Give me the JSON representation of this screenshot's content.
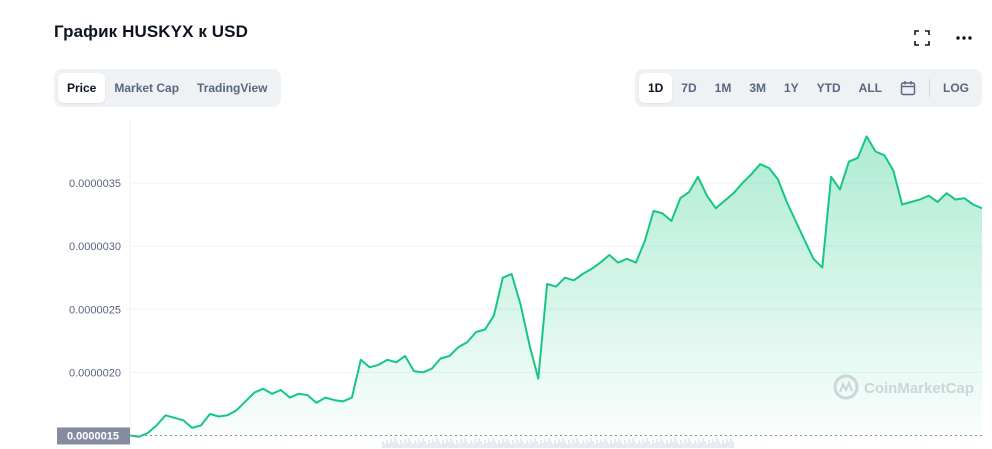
{
  "header": {
    "title": "График HUSKYX к USD"
  },
  "tabs_left": [
    {
      "label": "Price",
      "active": true
    },
    {
      "label": "Market Cap",
      "active": false
    },
    {
      "label": "TradingView",
      "active": false
    }
  ],
  "tabs_right": [
    {
      "label": "1D",
      "active": true
    },
    {
      "label": "7D",
      "active": false
    },
    {
      "label": "1M",
      "active": false
    },
    {
      "label": "3M",
      "active": false
    },
    {
      "label": "1Y",
      "active": false
    },
    {
      "label": "YTD",
      "active": false
    },
    {
      "label": "ALL",
      "active": false
    }
  ],
  "log_label": "LOG",
  "icons": {
    "fullscreen": "fullscreen-icon",
    "more": "more-icon",
    "calendar": "calendar-icon"
  },
  "watermark": "CoinMarketCap",
  "colors": {
    "line": "#16c784",
    "current_label_bg": "#858ca2",
    "accent": "#0d1421"
  },
  "chart_data": {
    "type": "area",
    "title": "График HUSKYX к USD",
    "xlabel": "",
    "ylabel": "",
    "ylim": [
      1.48e-06,
      4e-06
    ],
    "yticks": [
      "0.0000015",
      "0.0000020",
      "0.0000025",
      "0.0000030",
      "0.0000035"
    ],
    "ytick_values": [
      1.5e-06,
      2e-06,
      2.5e-06,
      3e-06,
      3.5e-06
    ],
    "grid": true,
    "current_price_label": "0.0000015",
    "series": [
      {
        "values": [
          1.5e-06,
          1.49e-06,
          1.52e-06,
          1.58e-06,
          1.66e-06,
          1.64e-06,
          1.62e-06,
          1.56e-06,
          1.58e-06,
          1.67e-06,
          1.65e-06,
          1.66e-06,
          1.7e-06,
          1.77e-06,
          1.84e-06,
          1.87e-06,
          1.83e-06,
          1.86e-06,
          1.8e-06,
          1.83e-06,
          1.82e-06,
          1.76e-06,
          1.8e-06,
          1.78e-06,
          1.77e-06,
          1.8e-06,
          2.1e-06,
          2.04e-06,
          2.06e-06,
          2.1e-06,
          2.08e-06,
          2.13e-06,
          2.01e-06,
          2e-06,
          2.03e-06,
          2.11e-06,
          2.13e-06,
          2.2e-06,
          2.24e-06,
          2.32e-06,
          2.34e-06,
          2.45e-06,
          2.75e-06,
          2.78e-06,
          2.54e-06,
          2.22e-06,
          1.95e-06,
          2.7e-06,
          2.68e-06,
          2.75e-06,
          2.73e-06,
          2.78e-06,
          2.82e-06,
          2.87e-06,
          2.93e-06,
          2.87e-06,
          2.9e-06,
          2.87e-06,
          3.04e-06,
          3.28e-06,
          3.26e-06,
          3.2e-06,
          3.38e-06,
          3.43e-06,
          3.55e-06,
          3.4e-06,
          3.3e-06,
          3.36e-06,
          3.42e-06,
          3.5e-06,
          3.57e-06,
          3.65e-06,
          3.62e-06,
          3.53e-06,
          3.35e-06,
          3.2e-06,
          3.05e-06,
          2.9e-06,
          2.83e-06,
          3.55e-06,
          3.45e-06,
          3.67e-06,
          3.7e-06,
          3.87e-06,
          3.75e-06,
          3.72e-06,
          3.6e-06,
          3.33e-06,
          3.35e-06,
          3.37e-06,
          3.4e-06,
          3.35e-06,
          3.42e-06,
          3.37e-06,
          3.38e-06,
          3.33e-06,
          3.3e-06
        ]
      }
    ]
  }
}
